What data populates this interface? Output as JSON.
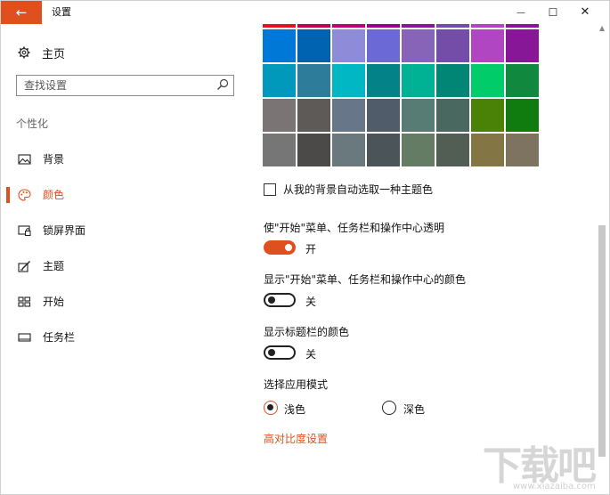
{
  "window": {
    "title": "设置",
    "back_glyph": "←",
    "minimize_glyph": "—",
    "maximize_glyph": "☐",
    "close_glyph": "✕"
  },
  "sidebar": {
    "home_label": "主页",
    "search_placeholder": "查找设置",
    "section_label": "个性化",
    "items": [
      {
        "label": "背景",
        "icon": "picture-icon"
      },
      {
        "label": "颜色",
        "icon": "palette-icon",
        "active": true
      },
      {
        "label": "锁屏界面",
        "icon": "lock-screen-icon"
      },
      {
        "label": "主题",
        "icon": "theme-brush-icon"
      },
      {
        "label": "开始",
        "icon": "start-grid-icon"
      },
      {
        "label": "任务栏",
        "icon": "taskbar-icon"
      }
    ]
  },
  "colors": {
    "accent": "#e0501f",
    "swatch_top_row": [
      "#e81123",
      "#c30052",
      "#bf0077",
      "#9a0089",
      "#881798",
      "#744da9",
      "#b146c2",
      "#881798"
    ],
    "swatch_rows": [
      [
        "#0078d7",
        "#0063b1",
        "#8e8cd8",
        "#6b69d6",
        "#8764b8",
        "#744da9",
        "#b146c2",
        "#881798"
      ],
      [
        "#0099bc",
        "#2d7d9a",
        "#00b7c3",
        "#038387",
        "#00b294",
        "#018574",
        "#00cc6a",
        "#10893e"
      ],
      [
        "#7a7574",
        "#5d5a58",
        "#68768a",
        "#515c6b",
        "#567c73",
        "#486860",
        "#498205",
        "#107c10"
      ],
      [
        "#767676",
        "#4c4a48",
        "#69797e",
        "#4a5459",
        "#647c64",
        "#525e54",
        "#847545",
        "#7e735f"
      ]
    ]
  },
  "main": {
    "auto_pick_label": "从我的背景自动选取一种主题色",
    "transparency": {
      "label": "使\"开始\"菜单、任务栏和操作中心透明",
      "state": "开"
    },
    "show_color_start": {
      "label": "显示\"开始\"菜单、任务栏和操作中心的颜色",
      "state": "关"
    },
    "show_color_title": {
      "label": "显示标题栏的颜色",
      "state": "关"
    },
    "app_mode": {
      "label": "选择应用模式",
      "light": "浅色",
      "dark": "深色"
    },
    "high_contrast_link": "高对比度设置"
  },
  "watermark": {
    "text": "下载吧",
    "url": "www.xiazaiba.com"
  }
}
